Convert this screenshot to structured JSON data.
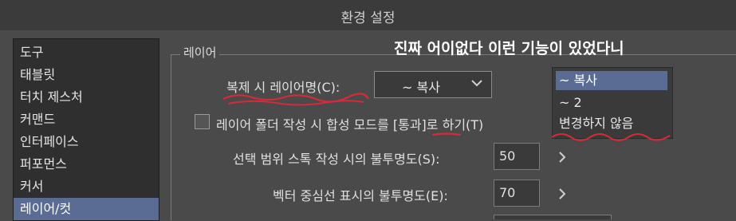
{
  "window": {
    "title": "환경 설정"
  },
  "sidebar": {
    "items": [
      {
        "label": "도구"
      },
      {
        "label": "태블릿"
      },
      {
        "label": "터치 제스처"
      },
      {
        "label": "커맨드"
      },
      {
        "label": "인터페이스"
      },
      {
        "label": "퍼포먼스"
      },
      {
        "label": "커서"
      },
      {
        "label": "레이어/컷"
      }
    ],
    "selected": "레이어/컷"
  },
  "layer_group": {
    "title": "레이어",
    "copy_name_label": "복제 시 레이어명(C):",
    "copy_name_value": "~ 복사",
    "copy_name_options": [
      "~ 복사",
      "~ 2",
      "변경하지 않음"
    ],
    "folder_checkbox_label": "레이어 폴더 작성 시 합성 모드를 [통과]로 하기(T)",
    "selection_stroke_label": "선택 범위 스톡 작성 시의 불투명도(S):",
    "selection_stroke_value": "50",
    "vector_center_label": "벡터 중심선 표시의 불투명도(E):",
    "vector_center_value": "70"
  },
  "annotation": {
    "text": "진짜 어이없다 이런 기능이 있었다니"
  },
  "colors": {
    "highlight": "#5a6c93",
    "annotation_underline": "#d42b3a"
  }
}
